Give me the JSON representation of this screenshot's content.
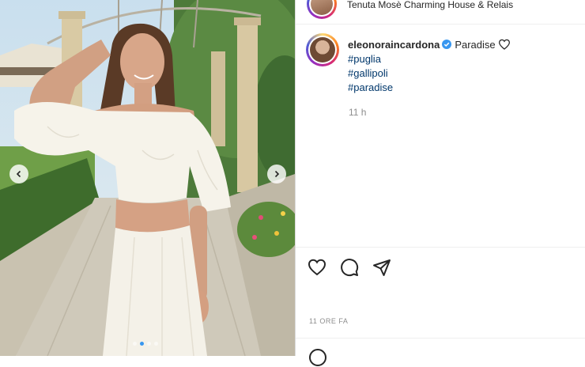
{
  "post": {
    "location": "Tenuta Mosè Charming House & Relais",
    "username": "eleonoraincardona",
    "caption_text": "Paradise",
    "hashtags": [
      "#puglia",
      "#gallipoli",
      "#paradise"
    ],
    "time_short": "11 h",
    "time_long": "11 ORE FA"
  },
  "carousel": {
    "slide_count": 4,
    "active_index": 1
  },
  "icons": {
    "prev": "chevron-left-icon",
    "next": "chevron-right-icon",
    "verified": "verified-badge-icon",
    "caption_emoji": "heart-outline-icon",
    "like": "heart-icon",
    "comment": "comment-icon",
    "share": "paper-plane-icon",
    "emoji": "emoji-icon"
  },
  "colors": {
    "verified": "#3897f0",
    "hashtag": "#00376b",
    "muted": "#8e8e8e",
    "text": "#262626"
  }
}
